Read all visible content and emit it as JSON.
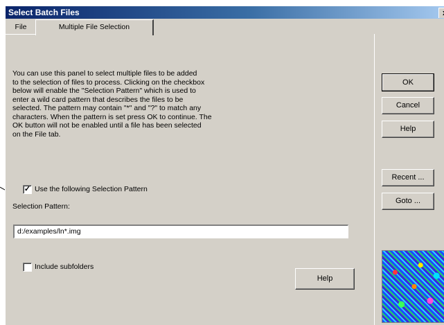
{
  "window": {
    "title": "Select Batch Files",
    "close_label": "x"
  },
  "tabs": [
    {
      "label": "File",
      "active": false
    },
    {
      "label": "Multiple File Selection",
      "active": true
    }
  ],
  "description": "You can use this panel to select multiple files to be added\nto the selection of files to process. Clicking on the checkbox\nbelow will enable the \"Selection Pattern\" which is used to\nenter a wild card pattern that describes the files to be\nselected. The pattern may contain \"*\" and \"?\" to match any\ncharacters. When the pattern is set press OK to continue. The\nOK button will not be enabled until a file has been selected\non the File tab.",
  "pattern_checkbox": {
    "label": "Use the following Selection Pattern",
    "checked": true,
    "mark": "✓"
  },
  "selection_pattern": {
    "label": "Selection Pattern:",
    "value": "d:/examples/ln*.img"
  },
  "subfolders_checkbox": {
    "label": "Include subfolders",
    "checked": false
  },
  "buttons": {
    "ok": "OK",
    "cancel": "Cancel",
    "help": "Help",
    "recent": "Recent ...",
    "goto": "Goto ...",
    "help_main": "Help"
  },
  "colors": {
    "dialog_bg": "#d4d0c8",
    "title_start": "#0a246a",
    "title_end": "#a6caf0"
  }
}
